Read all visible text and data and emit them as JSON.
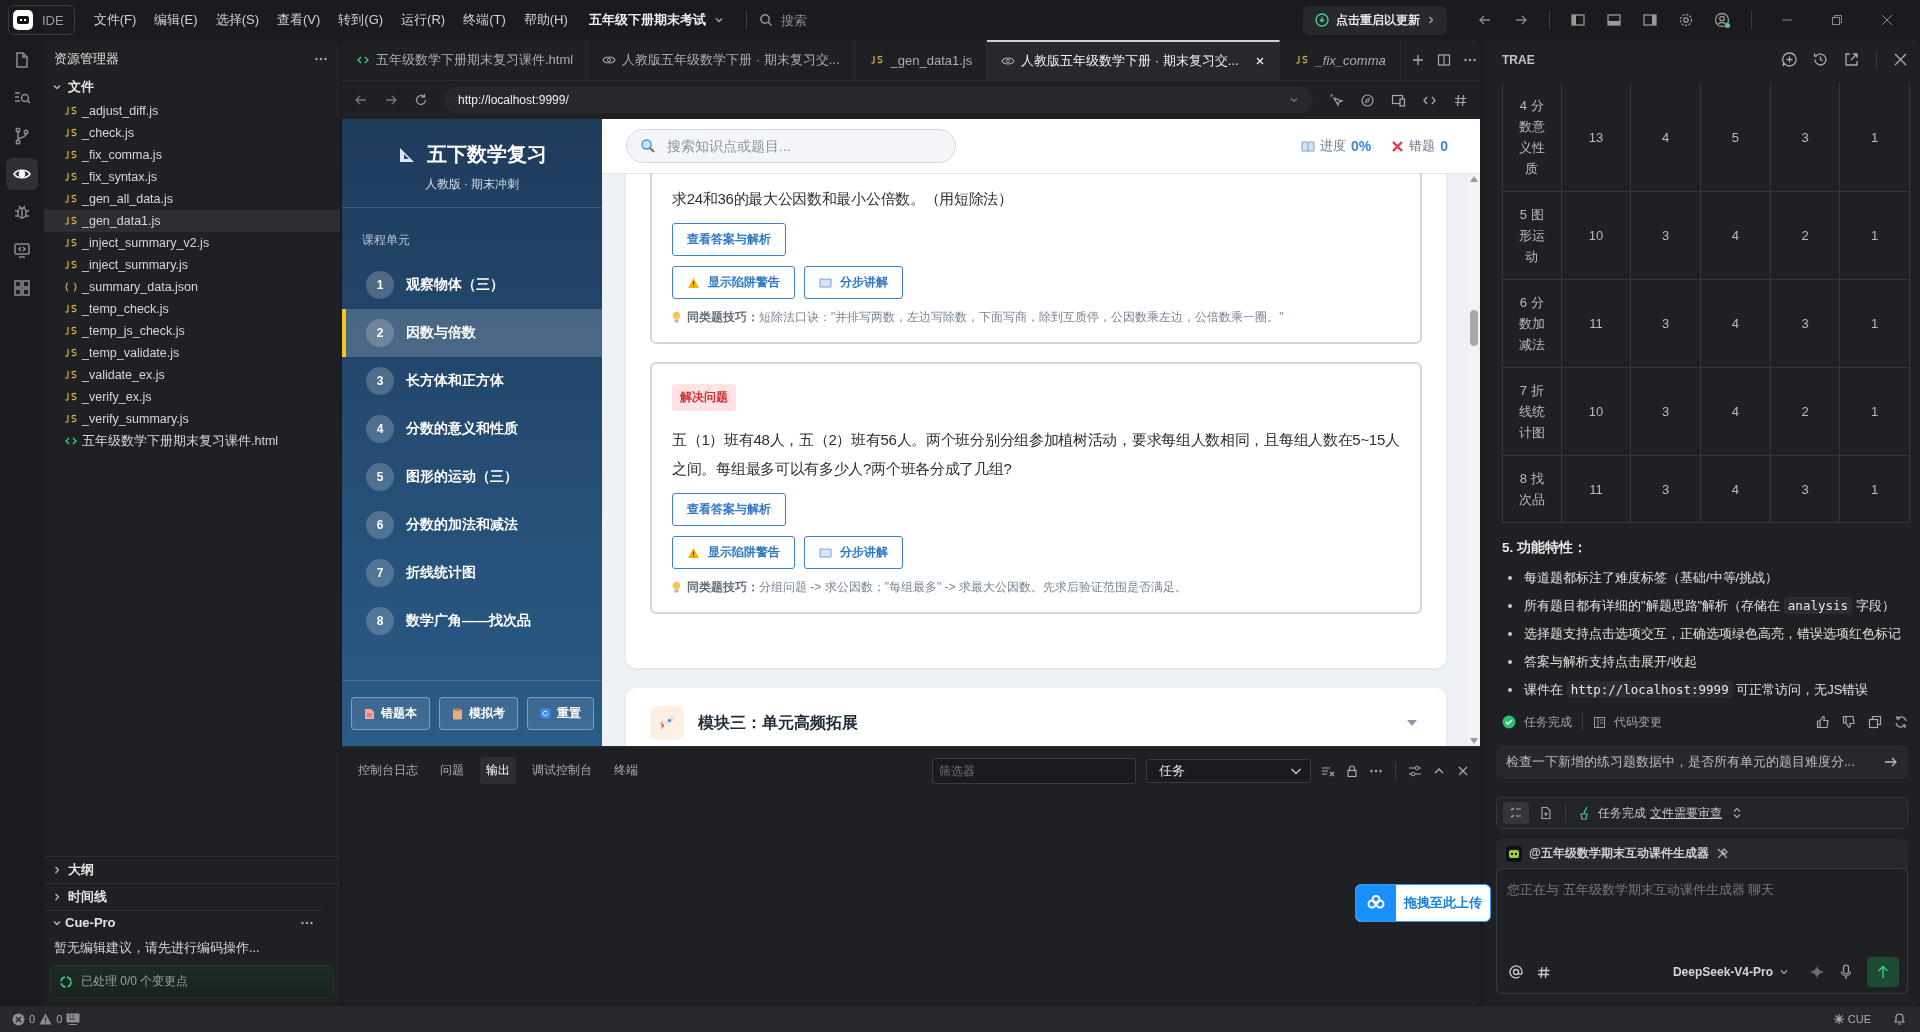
{
  "title_bar": {
    "app": "IDE",
    "menu": [
      "文件(F)",
      "编辑(E)",
      "选择(S)",
      "查看(V)",
      "转到(G)",
      "运行(R)",
      "终端(T)",
      "帮助(H)"
    ],
    "project": "五年级下册期末考试",
    "search_placeholder": "搜索",
    "update_button": "点击重启以更新"
  },
  "activity_bar": [
    {
      "kind": "files",
      "selected": false
    },
    {
      "kind": "search",
      "selected": false
    },
    {
      "kind": "branch",
      "selected": false
    },
    {
      "kind": "preview",
      "selected": true
    },
    {
      "kind": "debug",
      "selected": false
    },
    {
      "kind": "remote",
      "selected": false
    },
    {
      "kind": "extensions",
      "selected": false
    }
  ],
  "explorer": {
    "title": "资源管理器",
    "folder": "文件",
    "files": [
      {
        "name": "_adjust_diff.js",
        "kind": "js",
        "selected": false
      },
      {
        "name": "_check.js",
        "kind": "js",
        "selected": false
      },
      {
        "name": "_fix_comma.js",
        "kind": "js",
        "selected": false
      },
      {
        "name": "_fix_syntax.js",
        "kind": "js",
        "selected": false
      },
      {
        "name": "_gen_all_data.js",
        "kind": "js",
        "selected": false
      },
      {
        "name": "_gen_data1.js",
        "kind": "js",
        "selected": true
      },
      {
        "name": "_inject_summary_v2.js",
        "kind": "js",
        "selected": false
      },
      {
        "name": "_inject_summary.js",
        "kind": "js",
        "selected": false
      },
      {
        "name": "_summary_data.json",
        "kind": "json",
        "selected": false
      },
      {
        "name": "_temp_check.js",
        "kind": "js",
        "selected": false
      },
      {
        "name": "_temp_js_check.js",
        "kind": "js",
        "selected": false
      },
      {
        "name": "_temp_validate.js",
        "kind": "js",
        "selected": false
      },
      {
        "name": "_validate_ex.js",
        "kind": "js",
        "selected": false
      },
      {
        "name": "_verify_ex.js",
        "kind": "js",
        "selected": false
      },
      {
        "name": "_verify_summary.js",
        "kind": "js",
        "selected": false
      },
      {
        "name": "五年级数学下册期末复习课件.html",
        "kind": "html",
        "selected": false
      }
    ],
    "sections": [
      {
        "label": "大纲",
        "expanded": false
      },
      {
        "label": "时间线",
        "expanded": false
      }
    ],
    "cue_pro": {
      "label": "Cue-Pro",
      "expanded": true,
      "message": "暂无编辑建议，请先进行编码操作...",
      "status": "已处理 0/0 个变更点"
    }
  },
  "editor_tabs": [
    {
      "label": "五年级数学下册期末复习课件.html",
      "kind": "html",
      "selected": false
    },
    {
      "label": "人教版五年级数学下册 · 期末复习交...",
      "kind": "preview",
      "selected": false
    },
    {
      "label": "_gen_data1.js",
      "kind": "js",
      "selected": false
    },
    {
      "label": "人教版五年级数学下册 · 期末复习交...",
      "kind": "preview",
      "selected": true
    },
    {
      "label": "_fix_comma",
      "kind": "js",
      "selected": false
    }
  ],
  "browser": {
    "url": "http://localhost:9999/"
  },
  "page": {
    "brand": {
      "title": "五下数学复习",
      "subtitle": "人教版 · 期末冲刺"
    },
    "units_heading": "课程单元",
    "units": [
      {
        "number": "1",
        "label": "观察物体（三）",
        "selected": false
      },
      {
        "number": "2",
        "label": "因数与倍数",
        "selected": true
      },
      {
        "number": "3",
        "label": "长方体和正方体",
        "selected": false
      },
      {
        "number": "4",
        "label": "分数的意义和性质",
        "selected": false
      },
      {
        "number": "5",
        "label": "图形的运动（三）",
        "selected": false
      },
      {
        "number": "6",
        "label": "分数的加法和减法",
        "selected": false
      },
      {
        "number": "7",
        "label": "折线统计图",
        "selected": false
      },
      {
        "number": "8",
        "label": "数学广角——找次品",
        "selected": false
      }
    ],
    "footer_buttons": [
      {
        "label": "错题本",
        "kind": "notebook"
      },
      {
        "label": "模拟考",
        "kind": "exam"
      },
      {
        "label": "重置",
        "kind": "reset"
      }
    ],
    "search_placeholder": "搜索知识点或题目...",
    "progress": {
      "label": "进度",
      "value": "0%"
    },
    "mistakes": {
      "label": "错题",
      "value": "0"
    },
    "questions": [
      {
        "text": "求24和36的最大公因数和最小公倍数。（用短除法）",
        "actions": [
          {
            "label": "查看答案与解析",
            "kind": "answer"
          },
          {
            "label": "显示陷阱警告",
            "kind": "trap"
          },
          {
            "label": "分步讲解",
            "kind": "steps"
          }
        ],
        "tip": "**同类题技巧：**短除法口诀：\"并排写两数，左边写除数，下面写商，除到互质停，公因数乘左边，公倍数乘一圈。\""
      },
      {
        "tag": "解决问题",
        "text": "五（1）班有48人，五（2）班有56人。两个班分别分组参加植树活动，要求每组人数相同，且每组人数在5~15人之间。每组最多可以有多少人?两个班各分成了几组?",
        "actions": [
          {
            "label": "查看答案与解析",
            "kind": "answer"
          },
          {
            "label": "显示陷阱警告",
            "kind": "trap"
          },
          {
            "label": "分步讲解",
            "kind": "steps"
          }
        ],
        "tip": "**同类题技巧：**分组问题 -> 求公因数；\"每组最多\" -> 求最大公因数。先求后验证范围是否满足。"
      }
    ],
    "next_module": {
      "title": "模块三：单元高频拓展",
      "expanded": false
    }
  },
  "bottom_panel": {
    "tabs": [
      {
        "label": "控制台日志",
        "selected": false
      },
      {
        "label": "问题",
        "selected": false
      },
      {
        "label": "输出",
        "selected": true
      },
      {
        "label": "调试控制台",
        "selected": false
      },
      {
        "label": "终端",
        "selected": false
      }
    ],
    "filter_placeholder": "筛选器",
    "task_select": "任务"
  },
  "upload_button": "拖拽至此上传",
  "assistant": {
    "title": "TRAE",
    "table": {
      "rows": [
        [
          "4 分数意义性质",
          "13",
          "4",
          "5",
          "3",
          "1"
        ],
        [
          "5 图形运动",
          "10",
          "3",
          "4",
          "2",
          "1"
        ],
        [
          "6 分数加减法",
          "11",
          "3",
          "4",
          "3",
          "1"
        ],
        [
          "7 折线统计图",
          "10",
          "3",
          "4",
          "2",
          "1"
        ],
        [
          "8 找次品",
          "11",
          "3",
          "4",
          "3",
          "1"
        ]
      ]
    },
    "heading": "5. 功能特性：",
    "bullets": [
      [
        {
          "kind": "text",
          "text": "每道题都标注了难度标签（基础/中等/挑战）"
        }
      ],
      [
        {
          "kind": "text",
          "text": "所有题目都有详细的\"解题思路\"解析（存储在 "
        },
        {
          "kind": "code",
          "text": "analysis"
        },
        {
          "kind": "text",
          "text": " 字段）"
        }
      ],
      [
        {
          "kind": "text",
          "text": "选择题支持点击选项交互，正确选项绿色高亮，错误选项红色标记"
        }
      ],
      [
        {
          "kind": "text",
          "text": "答案与解析支持点击展开/收起"
        }
      ],
      [
        {
          "kind": "text",
          "text": "课件在 "
        },
        {
          "kind": "code",
          "text": "http://localhost:9999"
        },
        {
          "kind": "text",
          "text": " 可正常访问，无JS错误"
        }
      ]
    ],
    "task_status": "任务完成",
    "code_changes": "代码变更",
    "suggestion": "检查一下新增的练习题数据中，是否所有单元的题目难度分...",
    "review": {
      "status": "任务完成",
      "link": "文件需要审查"
    },
    "agent": "@五年级数学期末互动课件生成器",
    "input_placeholder": "您正在与 五年级数学期末互动课件生成器 聊天",
    "model": "DeepSeek-V4-Pro"
  },
  "status_bar": {
    "errors": "0",
    "warnings": "0",
    "cue": "CUE"
  }
}
